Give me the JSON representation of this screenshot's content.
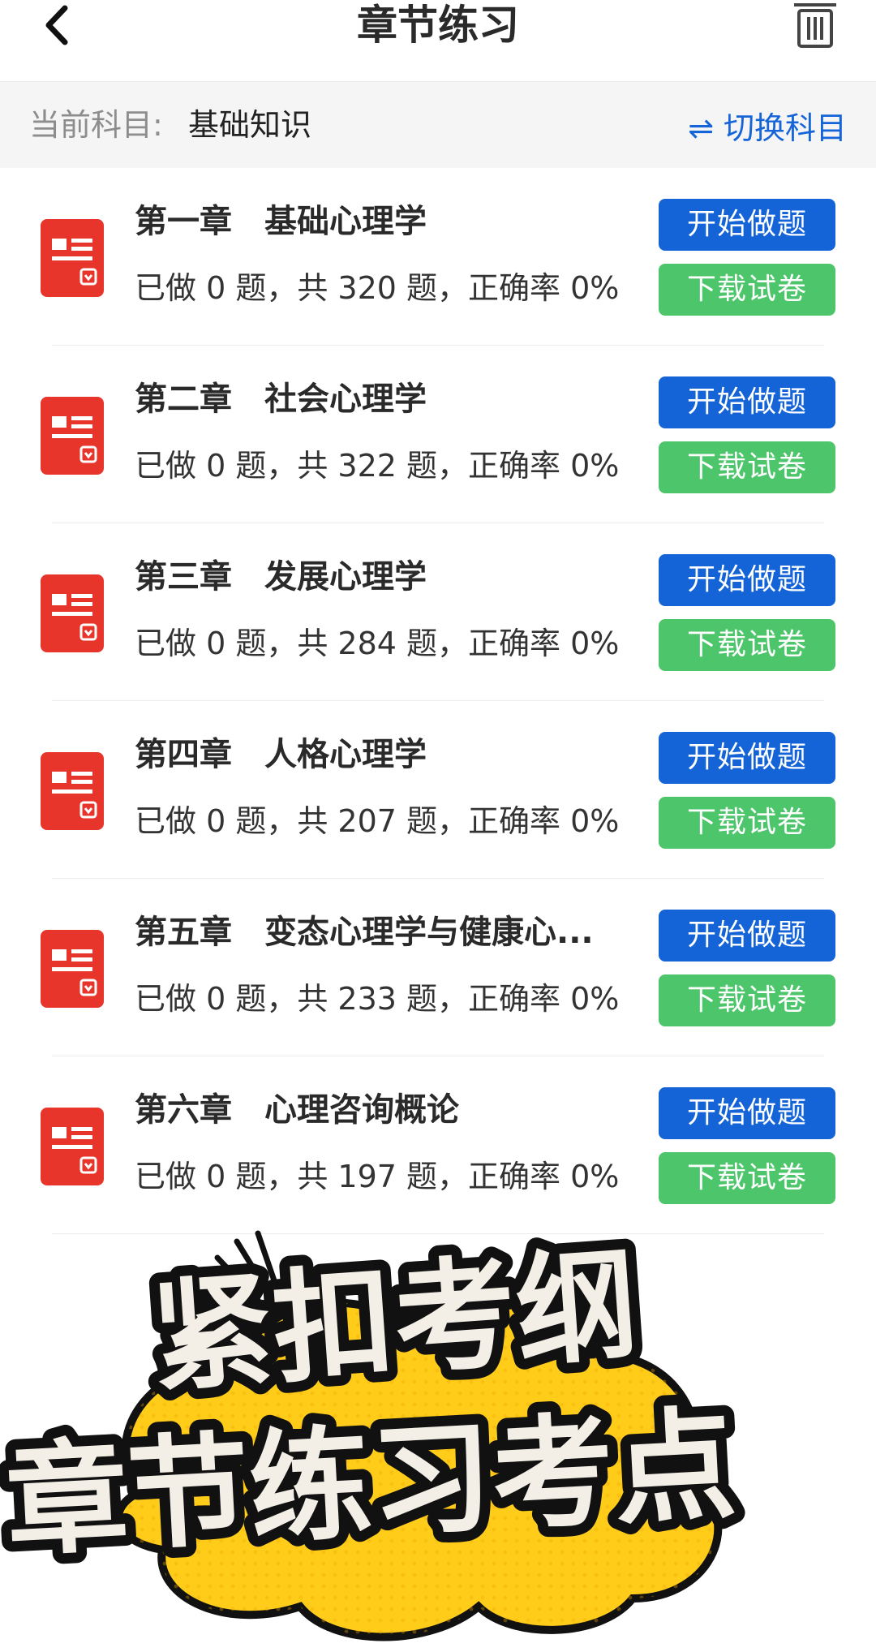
{
  "header": {
    "title": "章节练习",
    "back_icon": "chevron-left-icon",
    "trash_icon": "trash-icon"
  },
  "subject": {
    "label": "当前科目:",
    "value": "基础知识",
    "switch_label": "⇌ 切换科目"
  },
  "chapters": [
    {
      "title": "第一章　基础心理学",
      "stats": "已做 0 题，共 320 题，正确率 0%",
      "start_label": "开始做题",
      "download_label": "下载试卷"
    },
    {
      "title": "第二章　社会心理学",
      "stats": "已做 0 题，共 322 题，正确率 0%",
      "start_label": "开始做题",
      "download_label": "下载试卷"
    },
    {
      "title": "第三章　发展心理学",
      "stats": "已做 0 题，共 284 题，正确率 0%",
      "start_label": "开始做题",
      "download_label": "下载试卷"
    },
    {
      "title": "第四章　人格心理学",
      "stats": "已做 0 题，共 207 题，正确率 0%",
      "start_label": "开始做题",
      "download_label": "下载试卷"
    },
    {
      "title": "第五章　变态心理学与健康心...",
      "stats": "已做 0 题，共 233 题，正确率 0%",
      "start_label": "开始做题",
      "download_label": "下载试卷"
    },
    {
      "title": "第六章　心理咨询概论",
      "stats": "已做 0 题，共 197 题，正确率 0%",
      "start_label": "开始做题",
      "download_label": "下载试卷"
    }
  ],
  "promo": {
    "line1": "紧扣考纲",
    "line2": "章节练习考点"
  },
  "colors": {
    "primary_blue": "#1464d8",
    "download_green": "#4cc56b",
    "icon_red": "#e8352b",
    "promo_yellow": "#ffcc1a"
  }
}
